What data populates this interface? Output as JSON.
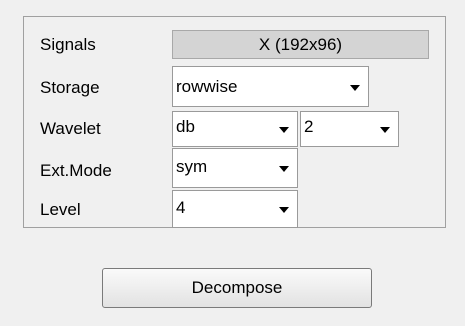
{
  "panel": {
    "signals": {
      "label": "Signals",
      "value": "X (192x96)"
    },
    "storage": {
      "label": "Storage",
      "value": "rowwise"
    },
    "wavelet": {
      "label": "Wavelet",
      "family": "db",
      "order": "2"
    },
    "extmode": {
      "label": "Ext.Mode",
      "value": "sym"
    },
    "level": {
      "label": "Level",
      "value": "4"
    }
  },
  "decompose_button": {
    "label": "Decompose"
  }
}
